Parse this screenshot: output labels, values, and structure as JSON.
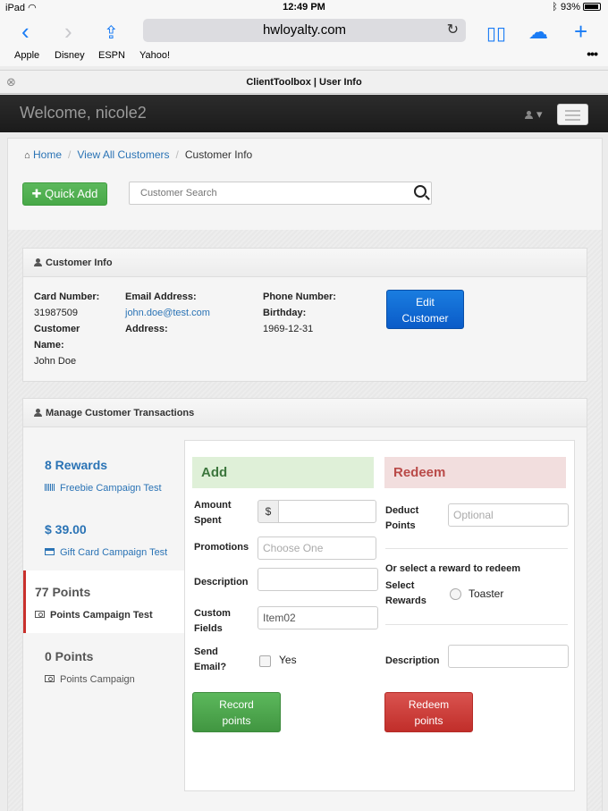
{
  "status_bar": {
    "device": "iPad",
    "time": "12:49 PM",
    "battery": "93%"
  },
  "browser": {
    "url": "hwloyalty.com",
    "bookmarks": [
      "Apple",
      "Disney",
      "ESPN",
      "Yahoo!"
    ],
    "more": "•••",
    "tab_title": "ClientToolbox | User Info"
  },
  "navbar": {
    "welcome": "Welcome, nicole2"
  },
  "breadcrumb": {
    "home": "Home",
    "customers": "View All Customers",
    "current": "Customer Info"
  },
  "actions": {
    "quick_add": "Quick Add",
    "search_placeholder": "Customer Search"
  },
  "customer_info": {
    "title": "Customer Info",
    "card_number_label": "Card Number:",
    "card_number": "31987509",
    "name_label_1": "Customer",
    "name_label_2": "Name:",
    "name": "John Doe",
    "email_label": "Email Address:",
    "email": "john.doe@test.com",
    "address_label": "Address:",
    "phone_label": "Phone Number:",
    "birthday_label": "Birthday:",
    "birthday": "1969-12-31",
    "edit_button_1": "Edit",
    "edit_button_2": "Customer"
  },
  "transactions": {
    "title": "Manage Customer Transactions",
    "campaigns": [
      {
        "value": "8 Rewards",
        "name": "Freebie Campaign Test",
        "icon": "barcode-icon",
        "active": false
      },
      {
        "value": "$ 39.00",
        "name": "Gift Card Campaign Test",
        "icon": "credit-card-icon",
        "active": false
      },
      {
        "value": "77 Points",
        "name": "Points Campaign Test",
        "icon": "money-icon",
        "active": true
      },
      {
        "value": "0 Points",
        "name": "Points Campaign",
        "icon": "money-icon",
        "active": false
      }
    ],
    "add": {
      "heading": "Add",
      "amount_spent_label_1": "Amount",
      "amount_spent_label_2": "Spent",
      "currency": "$",
      "promotions_label": "Promotions",
      "promotions_placeholder": "Choose One",
      "description_label": "Description",
      "custom_fields_label_1": "Custom",
      "custom_fields_label_2": "Fields",
      "custom_fields_value": "Item02",
      "send_email_label_1": "Send",
      "send_email_label_2": "Email?",
      "send_email_option": "Yes",
      "record_button_1": "Record",
      "record_button_2": "points"
    },
    "redeem": {
      "heading": "Redeem",
      "deduct_label_1": "Deduct",
      "deduct_label_2": "Points",
      "deduct_placeholder": "Optional",
      "or_select": "Or select a reward to redeem",
      "select_rewards_label_1": "Select",
      "select_rewards_label_2": "Rewards",
      "reward_option": "Toaster",
      "description_label": "Description",
      "redeem_button_1": "Redeem",
      "redeem_button_2": "points"
    }
  }
}
